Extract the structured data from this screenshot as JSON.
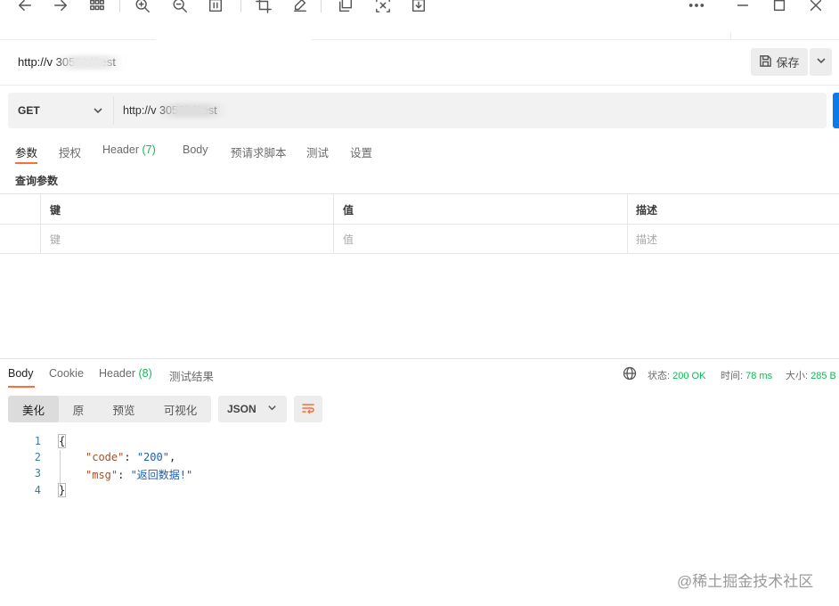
{
  "toolbar": {
    "icons": [
      "back-icon",
      "forward-icon",
      "grid-icon",
      "zoom-in-icon",
      "zoom-out-icon",
      "fit-page-icon",
      "crop-icon",
      "edit-icon",
      "copy-icon",
      "extract-text-icon",
      "download-icon",
      "more-icon"
    ],
    "window": [
      "minimize-icon",
      "maximize-icon",
      "close-icon"
    ]
  },
  "request": {
    "title": "http://v                   3050/al/test",
    "save_label": "保存",
    "method": "GET",
    "url": "http://v                    3050/al/test"
  },
  "req_tabs": [
    {
      "label": "参数",
      "count": ""
    },
    {
      "label": "授权",
      "count": ""
    },
    {
      "label": "Header ",
      "count": "(7)"
    },
    {
      "label": "Body",
      "count": ""
    },
    {
      "label": "预请求脚本",
      "count": ""
    },
    {
      "label": "测试",
      "count": ""
    },
    {
      "label": "设置",
      "count": ""
    }
  ],
  "params": {
    "title": "查询参数",
    "headers": [
      "键",
      "值",
      "描述"
    ],
    "placeholders": [
      "键",
      "值",
      "描述"
    ]
  },
  "response": {
    "tabs": [
      {
        "label": "Body",
        "count": ""
      },
      {
        "label": "Cookie",
        "count": ""
      },
      {
        "label": "Header ",
        "count": "(8)"
      },
      {
        "label": "测试结果",
        "count": ""
      }
    ],
    "status_label": "状态: ",
    "status_value": "200 OK",
    "time_label": "时间: ",
    "time_value": "78 ms",
    "size_label": "大小: ",
    "size_value": "285 B",
    "view_modes": [
      "美化",
      "原",
      "预览",
      "可视化"
    ],
    "format": "JSON",
    "line_numbers": [
      "1",
      "2",
      "3",
      "4"
    ],
    "code": {
      "open": "{",
      "key1": "\"code\"",
      "val1": "\"200\"",
      "key2": "\"msg\"",
      "val2": "\"返回数据!\"",
      "close": "}"
    }
  },
  "watermark": "@稀土掘金技术社区",
  "colors": {
    "accent": "#ff6c37",
    "ok": "#0cbb52",
    "send": "#097bed"
  }
}
